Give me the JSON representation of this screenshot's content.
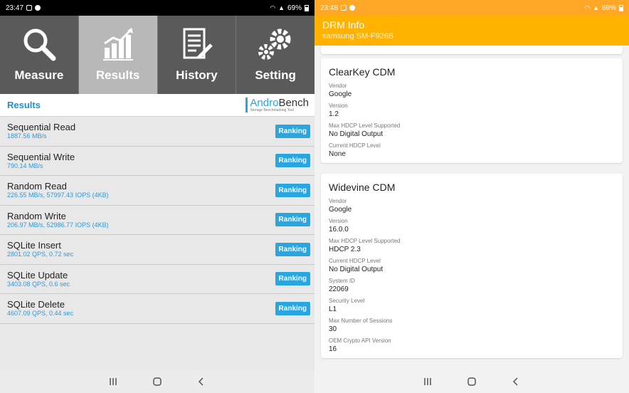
{
  "left": {
    "status": {
      "time": "23:47",
      "battery": "69%"
    },
    "tabs": [
      {
        "label": "Measure",
        "icon": "magnifier-icon"
      },
      {
        "label": "Results",
        "icon": "bar-chart-icon"
      },
      {
        "label": "History",
        "icon": "document-icon"
      },
      {
        "label": "Setting",
        "icon": "gears-icon"
      }
    ],
    "results_title": "Results",
    "logo": {
      "andro": "Andro",
      "bench": "Bench",
      "tagline": "Storage Benchmarking Tool"
    },
    "results": [
      {
        "name": "Sequential Read",
        "value": "1887.56 MB/s",
        "button": "Ranking"
      },
      {
        "name": "Sequential Write",
        "value": "790.14 MB/s",
        "button": "Ranking"
      },
      {
        "name": "Random Read",
        "value": "226.55 MB/s, 57997.43 IOPS (4KB)",
        "button": "Ranking"
      },
      {
        "name": "Random Write",
        "value": "206.97 MB/s, 52986.77 IOPS (4KB)",
        "button": "Ranking"
      },
      {
        "name": "SQLite Insert",
        "value": "2801.02 QPS, 0.72 sec",
        "button": "Ranking"
      },
      {
        "name": "SQLite Update",
        "value": "3403.08 QPS, 0.6 sec",
        "button": "Ranking"
      },
      {
        "name": "SQLite Delete",
        "value": "4607.09 QPS, 0.44 sec",
        "button": "Ranking"
      }
    ]
  },
  "right": {
    "status": {
      "time": "23:48",
      "battery": "69%"
    },
    "app_title": "DRM Info",
    "device": "samsung SM-F926B",
    "cards": [
      {
        "title": "ClearKey CDM",
        "fields": [
          {
            "label": "Vendor",
            "value": "Google"
          },
          {
            "label": "Version",
            "value": "1.2"
          },
          {
            "label": "Max HDCP Level Supported",
            "value": "No Digital Output"
          },
          {
            "label": "Current HDCP Level",
            "value": "None"
          }
        ]
      },
      {
        "title": "Widevine CDM",
        "fields": [
          {
            "label": "Vendor",
            "value": "Google"
          },
          {
            "label": "Version",
            "value": "16.0.0"
          },
          {
            "label": "Max HDCP Level Supported",
            "value": "HDCP 2.3"
          },
          {
            "label": "Current HDCP Level",
            "value": "No Digital Output"
          },
          {
            "label": "System ID",
            "value": "22069"
          },
          {
            "label": "Security Level",
            "value": "L1"
          },
          {
            "label": "Max Number of Sessions",
            "value": "30"
          },
          {
            "label": "OEM Crypto API Version",
            "value": "16"
          }
        ]
      }
    ]
  },
  "colors": {
    "accent_blue": "#29a6e0",
    "drm_amber": "#ffb300",
    "status_orange": "#ffa726"
  }
}
